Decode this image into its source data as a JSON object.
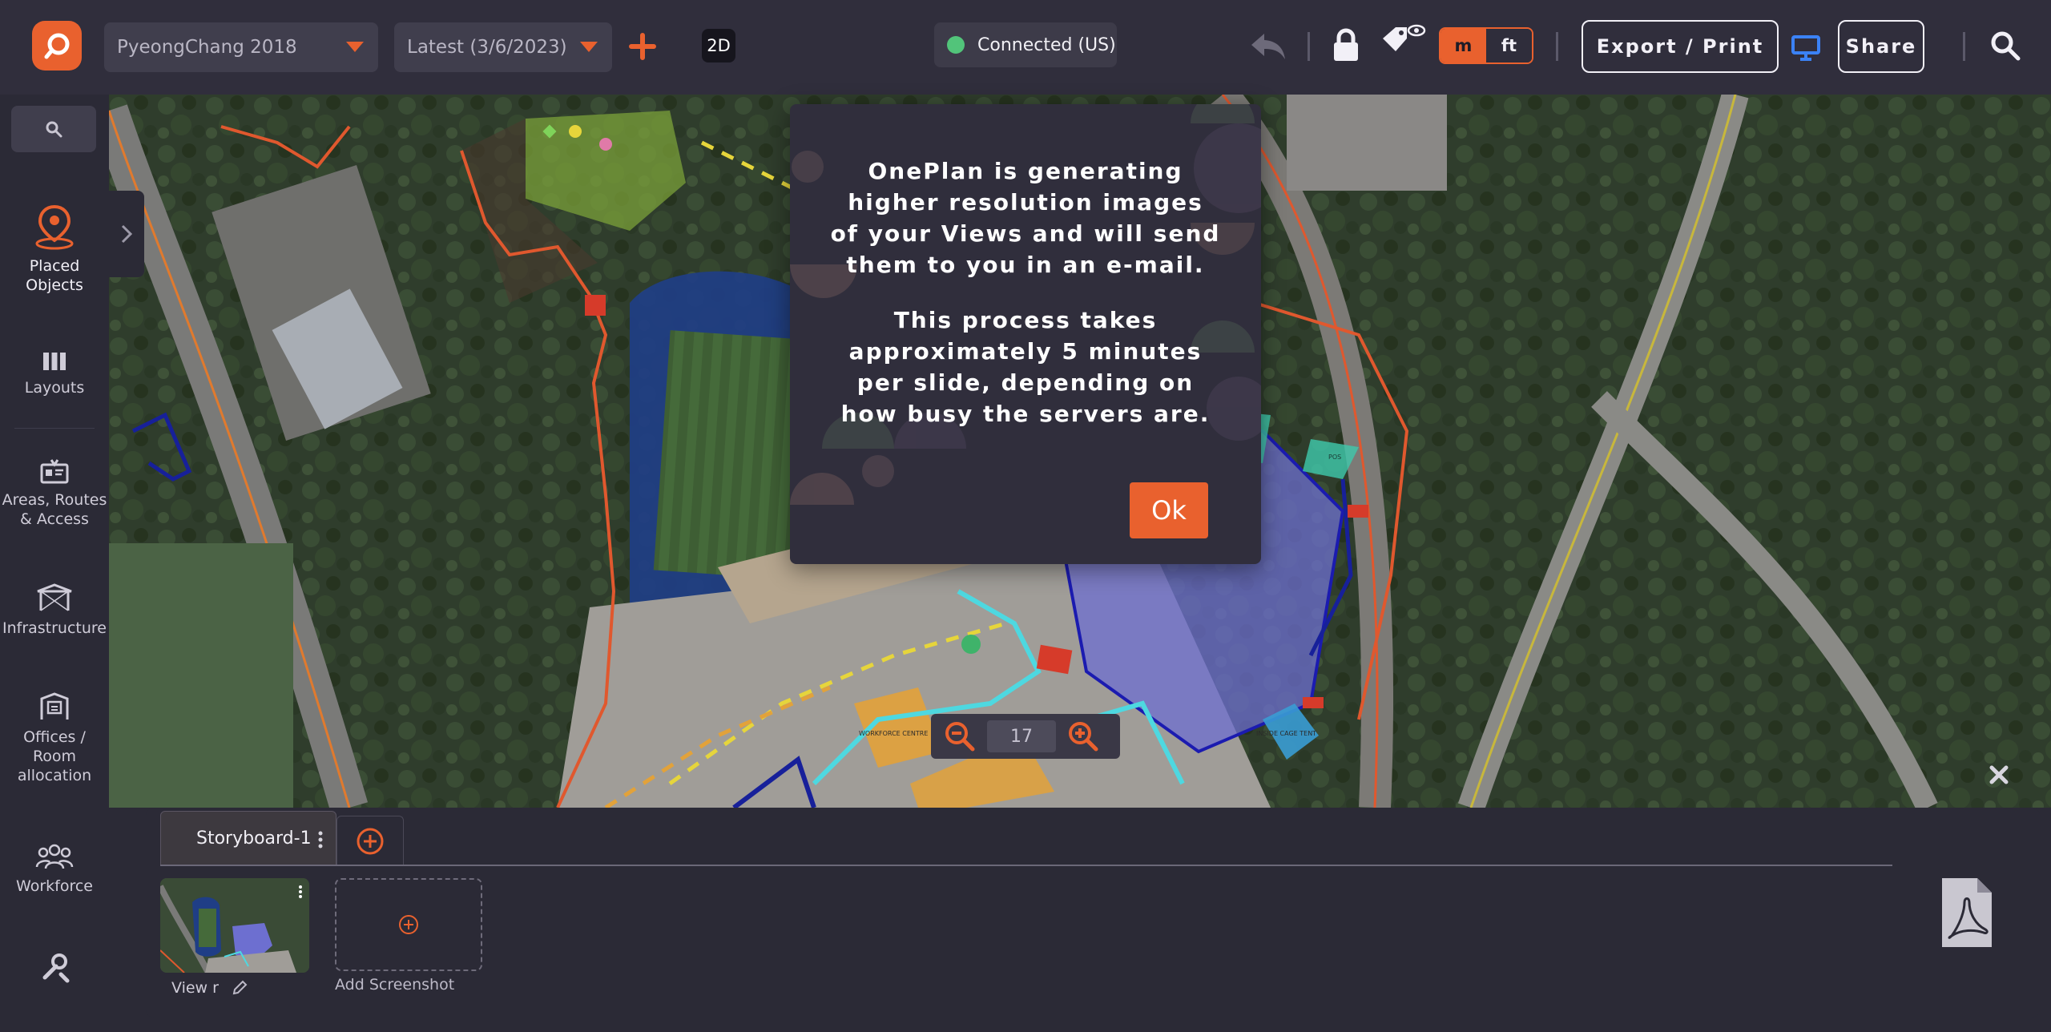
{
  "topbar": {
    "project_select": "PyeongChang 2018",
    "version_select": "Latest (3/6/2023)",
    "view_mode": "2D",
    "status_text": "Connected (US)",
    "unit_m": "m",
    "unit_ft": "ft",
    "export_label": "Export / Print",
    "share_label": "Share"
  },
  "sidebar": {
    "items": [
      {
        "label_1": "Placed",
        "label_2": "Objects"
      },
      {
        "label_1": "Layouts",
        "label_2": ""
      },
      {
        "label_1": "Areas, Routes",
        "label_2": "& Access"
      },
      {
        "label_1": "Infrastructure",
        "label_2": ""
      },
      {
        "label_1": "Offices /",
        "label_2": "Room",
        "label_3": "allocation"
      },
      {
        "label_1": "Workforce",
        "label_2": ""
      }
    ]
  },
  "map": {
    "zoom_level": "17",
    "labels": [
      "WORKFORCE CENTRE",
      "INSIDE CAGE TENT",
      "POS"
    ]
  },
  "modal": {
    "paragraph_1": "OnePlan is generating higher resolution images of your Views and will send them to you in an e-mail.",
    "paragraph_2": "This process takes approximately 5 minutes per slide, depending on how busy the servers are.",
    "ok_label": "Ok"
  },
  "storyboard": {
    "tab_label": "Storyboard-1",
    "view_label": "View r",
    "add_screenshot_label": "Add Screenshot"
  },
  "colors": {
    "accent": "#e9612e",
    "background": "#2b2a36",
    "topbar": "#302e3c",
    "connected": "#52c47a"
  }
}
